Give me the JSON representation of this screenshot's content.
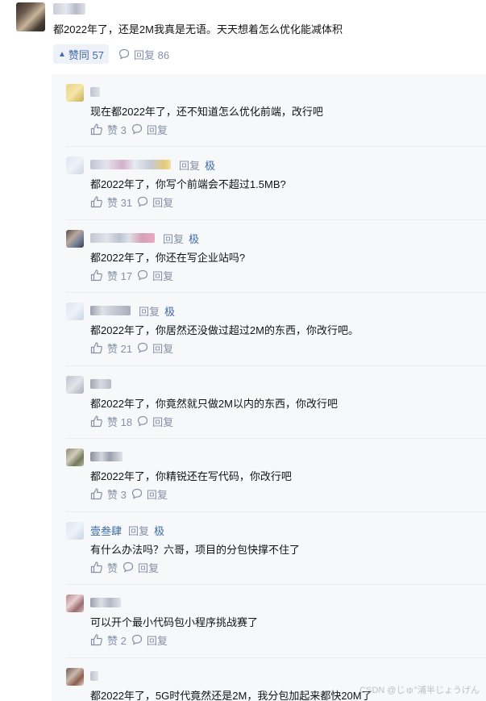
{
  "top_comment": {
    "content": "都2022年了，还是2M我真是无语。天天想着怎么优化能减体积",
    "vote_label": "赞同 57",
    "reply_label": "回复 86"
  },
  "replies": [
    {
      "text": "现在都2022年了，还不知道怎么优化前端，改行吧",
      "likes": "赞 3",
      "reply": "回复",
      "head_reply": "",
      "tag": "",
      "user": ""
    },
    {
      "text": "都2022年了，你写个前端会不超过1.5MB?",
      "likes": "赞 31",
      "reply": "回复",
      "head_reply": "回复",
      "tag": "极",
      "user": ""
    },
    {
      "text": "都2022年了，你还在写企业站吗?",
      "likes": "赞 17",
      "reply": "回复",
      "head_reply": "回复",
      "tag": "极",
      "user": ""
    },
    {
      "text": "都2022年了，你居然还没做过超过2M的东西，你改行吧。",
      "likes": "赞 21",
      "reply": "回复",
      "head_reply": "回复",
      "tag": "极",
      "user": ""
    },
    {
      "text": "都2022年了，你竟然就只做2M以内的东西，你改行吧",
      "likes": "赞 18",
      "reply": "回复",
      "head_reply": "",
      "tag": "",
      "user": ""
    },
    {
      "text": "都2022年了，你精锐还在写代码，你改行吧",
      "likes": "赞 3",
      "reply": "回复",
      "head_reply": "",
      "tag": "",
      "user": ""
    },
    {
      "text": "有什么办法吗？六哥，项目的分包快撑不住了",
      "likes": "赞",
      "reply": "回复",
      "head_reply": "回复",
      "tag": "极",
      "user": "壹叁肆"
    },
    {
      "text": "可以开个最小代码包小程序挑战赛了",
      "likes": "赞 2",
      "reply": "回复",
      "head_reply": "",
      "tag": "",
      "user": ""
    },
    {
      "text": "都2022年了，5G时代竟然还是2M，我分包加起来都快20M了",
      "likes": "",
      "reply": "",
      "head_reply": "",
      "tag": "",
      "user": ""
    }
  ],
  "watermark": "CSDN @じゅ°浦半じょうげん"
}
